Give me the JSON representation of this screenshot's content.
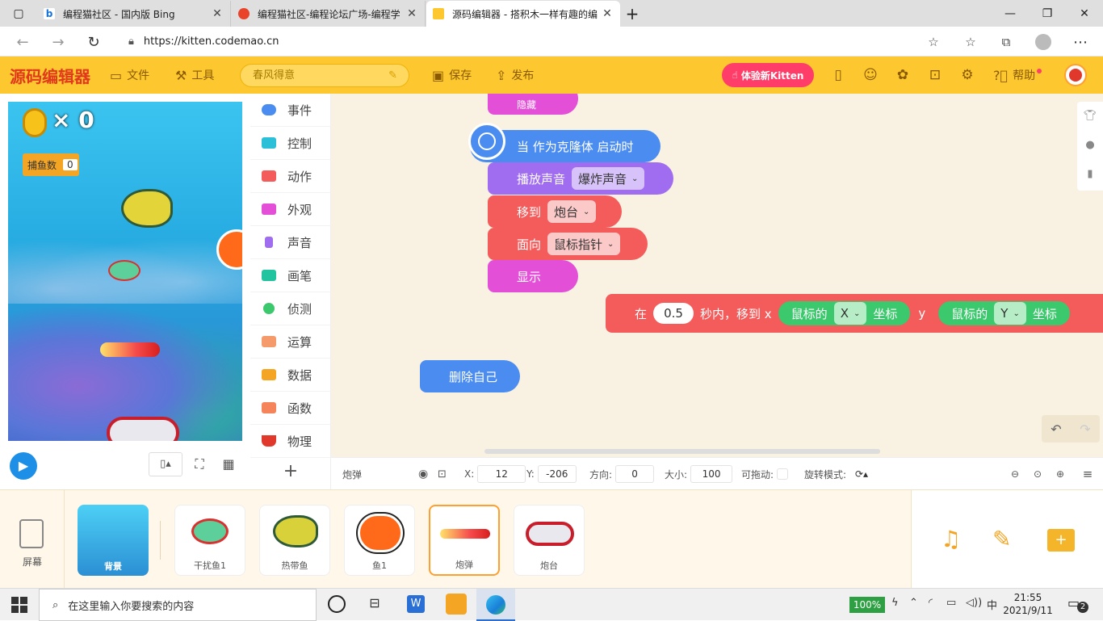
{
  "browser": {
    "tabs": [
      {
        "title": "编程猫社区 - 国内版 Bing",
        "icon": "bing-icon"
      },
      {
        "title": "编程猫社区-编程论坛广场-编程学",
        "icon": "codemao-icon"
      },
      {
        "title": "源码编辑器 - 搭积木一样有趣的编",
        "icon": "kitten-icon"
      }
    ],
    "url": "https://kitten.codemao.cn"
  },
  "header": {
    "logo": "源码编辑器",
    "file": "文件",
    "tools": "工具",
    "project_name": "春风得意",
    "save": "保存",
    "publish": "发布",
    "try_kitten": "体验新Kitten",
    "help": "帮助"
  },
  "stage": {
    "coin_count": "× 0",
    "catch_label": "捕鱼数",
    "catch_value": "0"
  },
  "categories": [
    {
      "label": "事件",
      "color": "#4a8cf0"
    },
    {
      "label": "控制",
      "color": "#2bc0d8"
    },
    {
      "label": "动作",
      "color": "#f45b5b"
    },
    {
      "label": "外观",
      "color": "#e44fd8"
    },
    {
      "label": "声音",
      "color": "#a06cf0"
    },
    {
      "label": "画笔",
      "color": "#22c4a0"
    },
    {
      "label": "侦测",
      "color": "#3cc86c"
    },
    {
      "label": "运算",
      "color": "#f59a6b"
    },
    {
      "label": "数据",
      "color": "#f5a524"
    },
    {
      "label": "函数",
      "color": "#f5845b"
    },
    {
      "label": "物理",
      "color": "#e0392c"
    }
  ],
  "add_category": "+",
  "blocks": {
    "top_partial": "隐藏",
    "hat": "当 作为克隆体 启动时",
    "play_sound": "播放声音",
    "sound_name": "爆炸声音",
    "move_to": "移到",
    "move_target": "炮台",
    "face": "面向",
    "face_target": "鼠标指针",
    "show": "显示",
    "glide_in": "在",
    "glide_secs": "0.5",
    "glide_mid": "秒内，移到 x",
    "mouse_x_prefix": "鼠标的",
    "mouse_x_axis": "X",
    "coord": "坐标",
    "y_label": "y",
    "mouse_y_prefix": "鼠标的",
    "mouse_y_axis": "Y",
    "delete_self": "删除自己"
  },
  "props": {
    "sprite_name": "炮弹",
    "x_label": "X:",
    "x_value": "12",
    "y_label": "Y:",
    "y_value": "-206",
    "dir_label": "方向:",
    "dir_value": "0",
    "size_label": "大小:",
    "size_value": "100",
    "drag_label": "可拖动:",
    "rotate_label": "旋转模式:"
  },
  "sprites": {
    "screen_label": "屏幕",
    "background_label": "背景",
    "items": [
      "干扰鱼1",
      "热带鱼",
      "鱼1",
      "炮弹",
      "炮台"
    ],
    "selected": "炮弹"
  },
  "taskbar": {
    "search_placeholder": "在这里输入你要搜索的内容",
    "battery": "100%",
    "ime": "中",
    "time": "21:55",
    "date": "2021/9/11",
    "notif_count": "2"
  }
}
